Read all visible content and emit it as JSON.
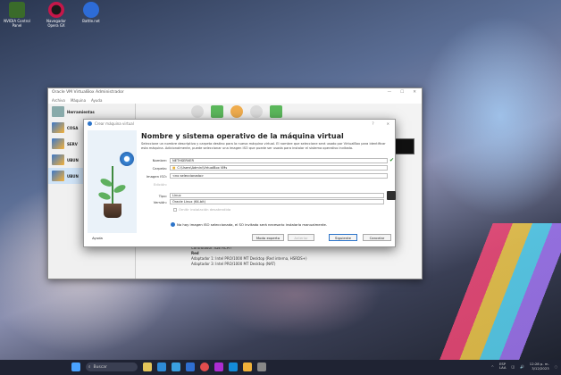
{
  "desktop": {
    "icons": [
      {
        "label": "NVIDIA Control Panel",
        "color": "#3a6b2a"
      },
      {
        "label": "Navegador Opera GX",
        "color": "#c5174a"
      },
      {
        "label": "Battle.net",
        "color": "#2d6cd8"
      }
    ]
  },
  "main_window": {
    "title": "Oracle VM VirtualBox Administrador",
    "menu": [
      "Archivo",
      "Máquina",
      "Ayuda"
    ],
    "sidebar": [
      {
        "label": "Herramientas"
      },
      {
        "label": "COSA"
      },
      {
        "label": "SERV"
      },
      {
        "label": "UBUN"
      },
      {
        "label": "UBUN"
      }
    ],
    "details": [
      "Controlador:      IDE ACPI?",
      "Red",
      "Adaptador 1:  Intel PRO/1000 MT Desktop (Red interna, HSRDS+)",
      "Adaptador 3:  Intel PRO/1000 MT Desktop (NAT)"
    ]
  },
  "dialog": {
    "title": "Crear máquina virtual",
    "heading": "Nombre y sistema operativo de la máquina virtual",
    "description": "Seleccione un nombre descriptivo y carpeta destino para la nueva máquina virtual. El nombre que seleccione será usado por VirtualBox para identificar esta máquina. Adicionalmente, puede seleccionar una imagen ISO que puede ser usada para instalar el sistema operativo invitado.",
    "name_label": "Nombre:",
    "name_value": "NETHSERVER",
    "folder_label": "Carpeta:",
    "folder_value": "C:\\Users\\Admin\\VirtualBox VMs",
    "iso_label": "Imagen ISO:",
    "iso_value": "<no seleccionado>",
    "edition_label": "Edición:",
    "type_label": "Tipo:",
    "type_value": "Linux",
    "version_label": "Versión:",
    "version_value": "Oracle Linux (64-bit)",
    "skip_label": "Omitir instalación desatendida",
    "info": "No hay imagen ISO seleccionada, el SO invitado será necesario instalarlo manualmente.",
    "buttons": {
      "help": "Ayuda",
      "expert": "Modo experto",
      "back": "Anterior",
      "next": "Siguiente",
      "cancel": "Cancelar"
    }
  },
  "taskbar": {
    "search": "Buscar",
    "lang": "ESP\nLAA",
    "time": "12:28 p. m.",
    "date": "3/12/2023"
  }
}
